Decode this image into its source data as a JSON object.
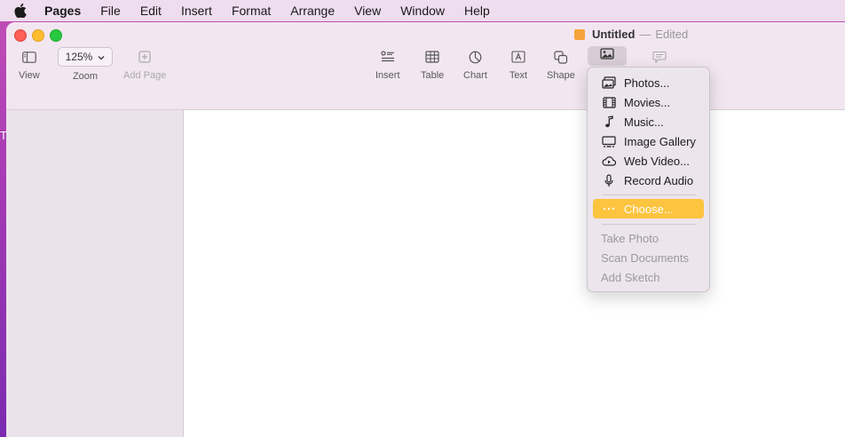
{
  "menubar": {
    "app": "Pages",
    "items": [
      "File",
      "Edit",
      "Insert",
      "Format",
      "Arrange",
      "View",
      "Window",
      "Help"
    ]
  },
  "desktop": {
    "text": "To"
  },
  "window": {
    "title": "Untitled",
    "separator": "—",
    "status": "Edited"
  },
  "toolbar": {
    "view": "View",
    "zoom_value": "125%",
    "zoom": "Zoom",
    "add_page": "Add Page",
    "insert": "Insert",
    "table": "Table",
    "chart": "Chart",
    "text": "Text",
    "shape": "Shape"
  },
  "media_menu": {
    "items": [
      {
        "label": "Photos...",
        "icon": "photos-icon"
      },
      {
        "label": "Movies...",
        "icon": "film-icon"
      },
      {
        "label": "Music...",
        "icon": "music-note-icon"
      },
      {
        "label": "Image Gallery",
        "icon": "image-gallery-icon"
      },
      {
        "label": "Web Video...",
        "icon": "cloud-play-icon"
      },
      {
        "label": "Record Audio",
        "icon": "microphone-icon"
      }
    ],
    "choose": {
      "label": "Choose...",
      "icon": "ellipsis-icon"
    },
    "disabled_items": [
      "Take Photo",
      "Scan Documents",
      "Add Sketch"
    ]
  },
  "colors": {
    "highlight": "#fcc43f",
    "menubar": "#eedcef",
    "toolbar": "#f2e6f0"
  }
}
